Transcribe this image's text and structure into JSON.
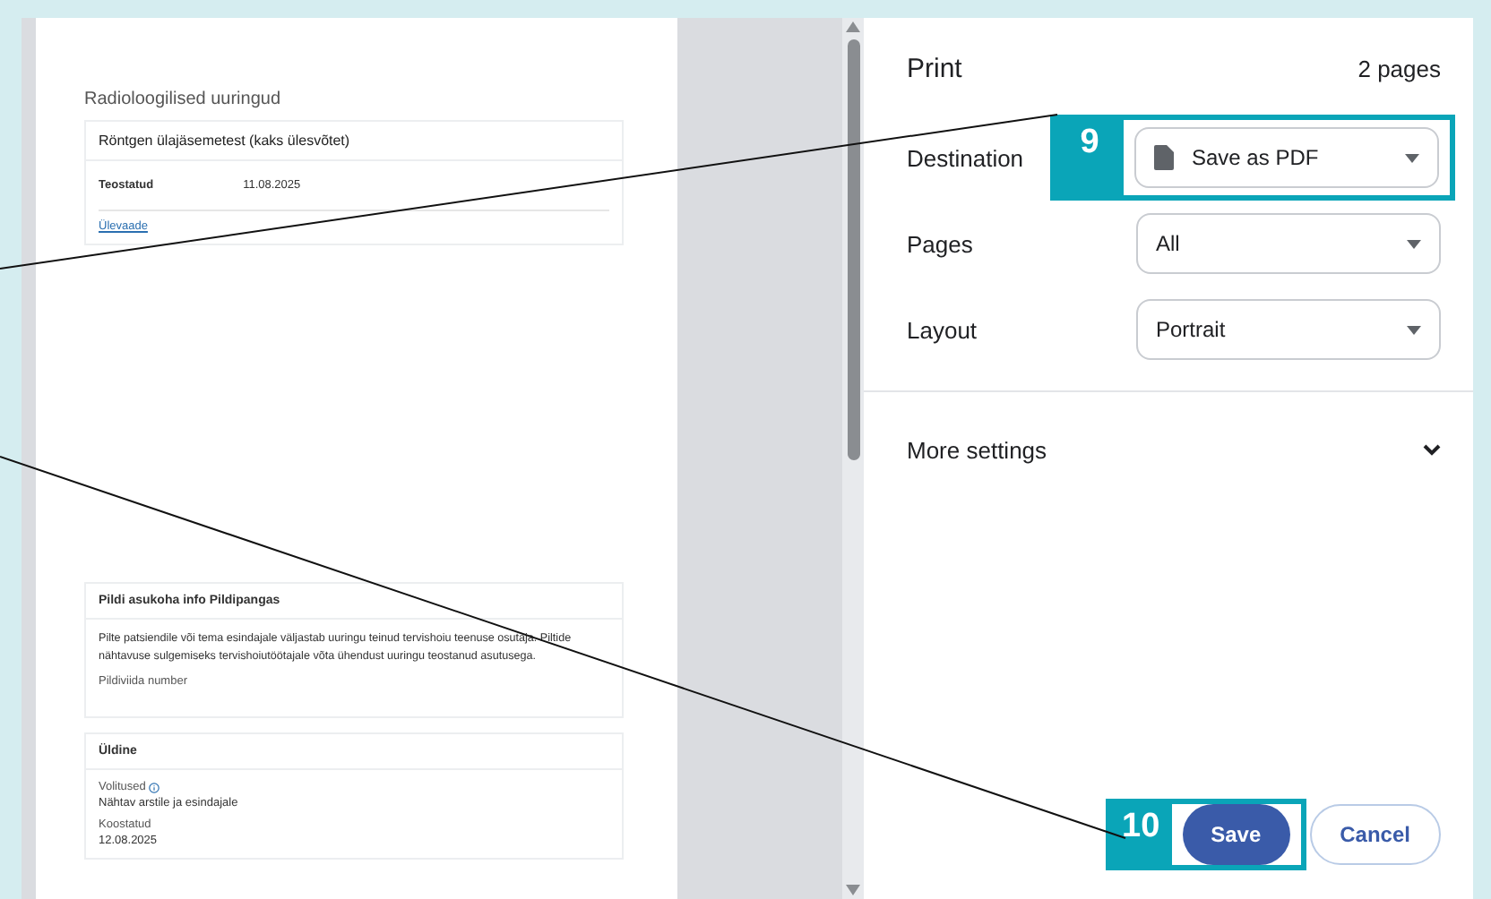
{
  "preview": {
    "section_title": "Radioloogilised uuringud",
    "study_card": {
      "title": "Röntgen ülajäsemetest (kaks ülesvõtet)",
      "field_label": "Teostatud",
      "field_value": "11.08.2025",
      "link": "Ülevaade"
    },
    "location_card": {
      "title": "Pildi asukoha info Pildipangas",
      "text": "Pilte patsiendile või tema esindajale väljastab uuringu teinud tervishoiu teenuse osutaja. Piltide nähtavuse sulgemiseks tervishoiutöötajale võta ühendust uuringu teostanud asutusega.",
      "field_label": "Pildiviida number"
    },
    "general_card": {
      "title": "Üldine",
      "fields": [
        {
          "label": "Volitused",
          "info": true,
          "value": "Nähtav arstile ja esindajale"
        },
        {
          "label": "Koostatud",
          "info": false,
          "value": "12.08.2025"
        }
      ]
    }
  },
  "print_panel": {
    "title": "Print",
    "page_count": "2 pages",
    "settings": [
      {
        "label": "Destination",
        "value": "Save as PDF",
        "kind": "file"
      },
      {
        "label": "Pages",
        "value": "All",
        "kind": "plain"
      },
      {
        "label": "Layout",
        "value": "Portrait",
        "kind": "plain"
      }
    ],
    "more_settings": "More settings",
    "buttons": [
      {
        "label": "Save",
        "kind": "primary"
      },
      {
        "label": "Cancel",
        "kind": "secondary"
      }
    ]
  },
  "callouts": [
    {
      "number": "9"
    },
    {
      "number": "10"
    }
  ]
}
